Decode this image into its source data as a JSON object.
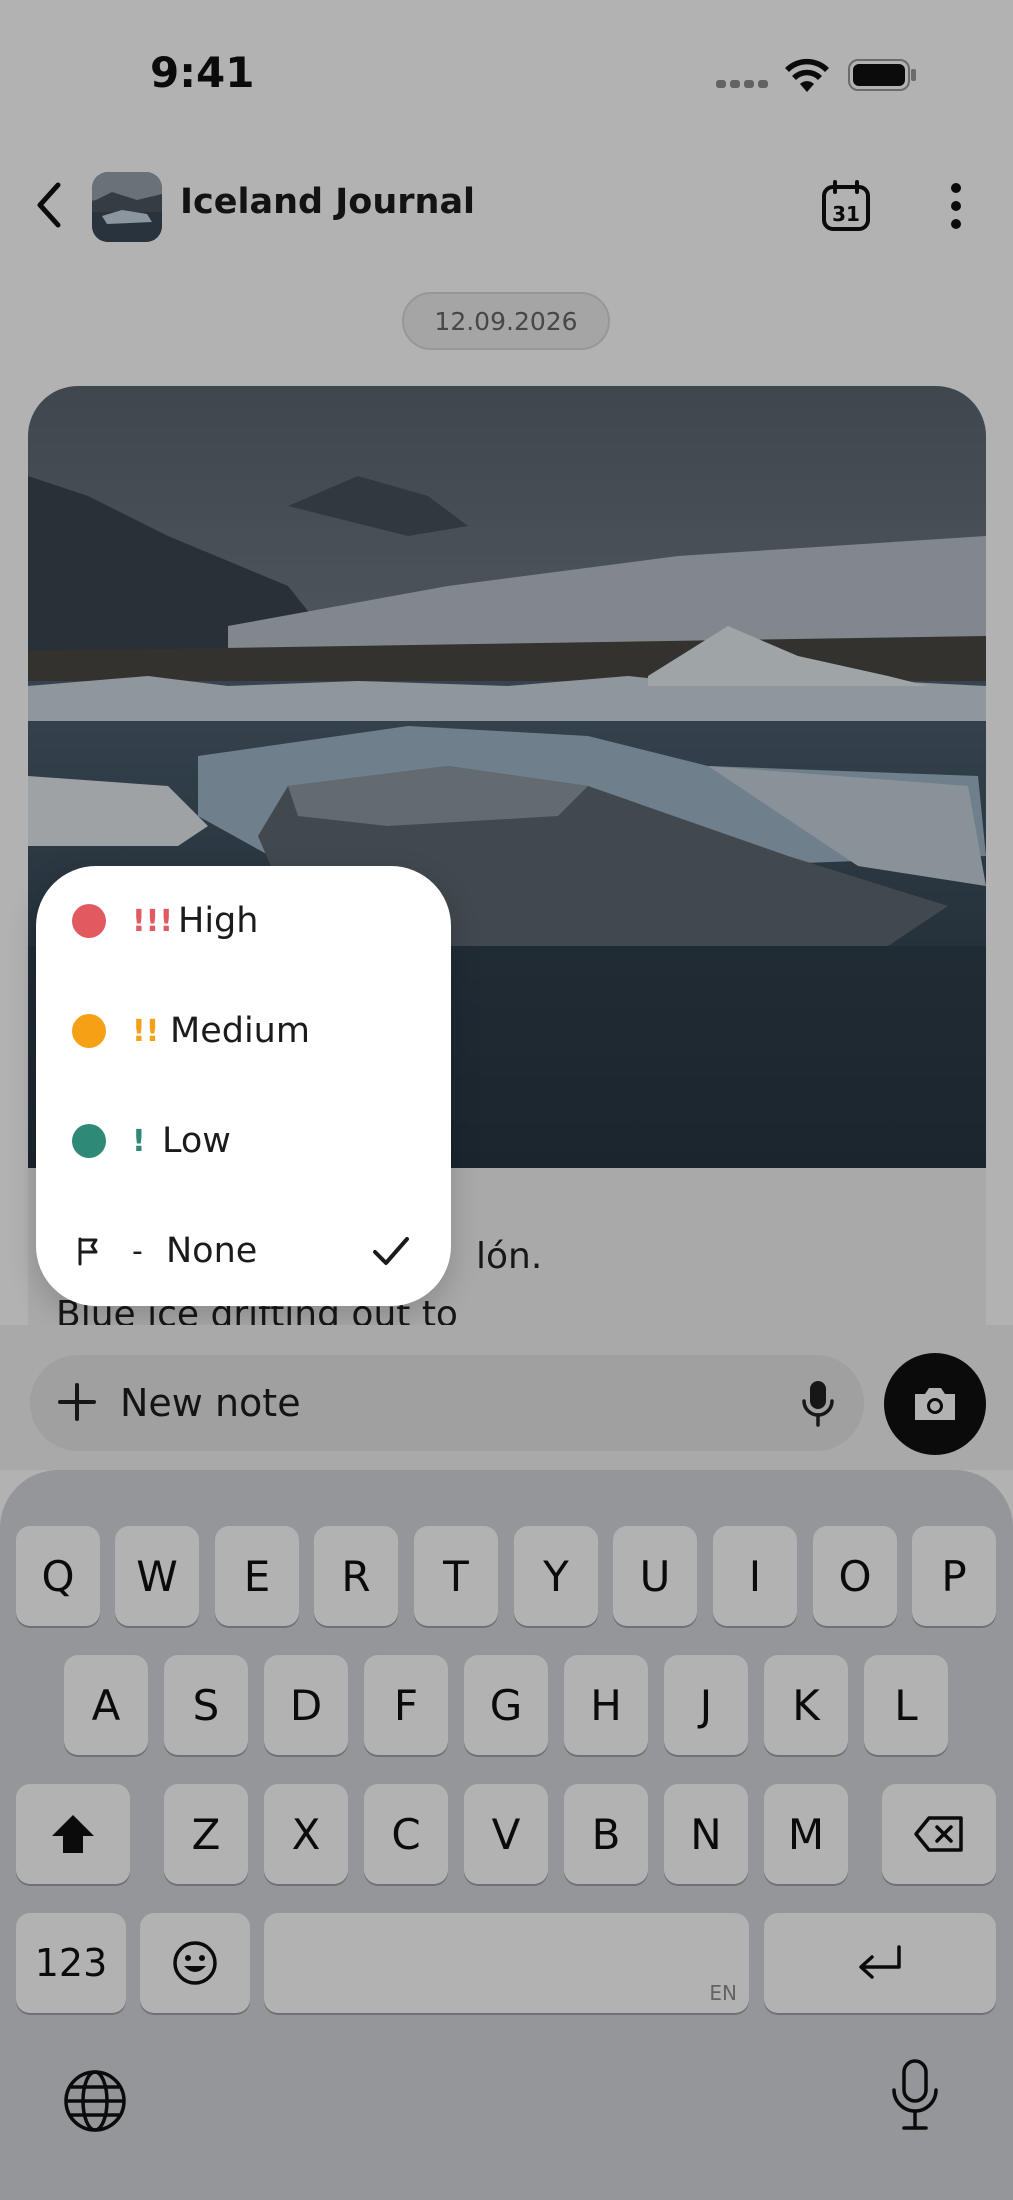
{
  "status_bar": {
    "time": "9:41",
    "icons": [
      "signal-dots-icon",
      "wifi-icon",
      "battery-icon"
    ]
  },
  "header": {
    "back_icon": "chevron-left-icon",
    "title": "Iceland Journal",
    "calendar_day": "31",
    "more_icon": "more-vertical-icon"
  },
  "date_chip": "12.09.2026",
  "note": {
    "text_line1": "- None                    lón.",
    "visible_text_1": "lón.",
    "visible_text_2": "Blue ice drifting out to"
  },
  "priority_menu": {
    "items": [
      {
        "mark": "!!!",
        "label": "High",
        "color": "#e05a5f"
      },
      {
        "mark": "!!",
        "label": "Medium",
        "color": "#f5a015"
      },
      {
        "mark": "!",
        "label": "Low",
        "color": "#2e8a76"
      },
      {
        "mark": "-",
        "label": "None",
        "selected": true
      }
    ]
  },
  "input_bar": {
    "placeholder": "New note",
    "left_icon": "plus-icon",
    "mic_icon": "microphone-icon",
    "camera_icon": "camera-icon"
  },
  "keyboard": {
    "row1": [
      "Q",
      "W",
      "E",
      "R",
      "T",
      "Y",
      "U",
      "I",
      "O",
      "P"
    ],
    "row2": [
      "A",
      "S",
      "D",
      "F",
      "G",
      "H",
      "J",
      "K",
      "L"
    ],
    "row3": [
      "Z",
      "X",
      "C",
      "V",
      "B",
      "N",
      "M"
    ],
    "numbers_key": "123",
    "space_lang": "EN",
    "icons": [
      "shift-icon",
      "backspace-icon",
      "emoji-icon",
      "return-icon",
      "globe-icon",
      "dictation-icon"
    ]
  }
}
